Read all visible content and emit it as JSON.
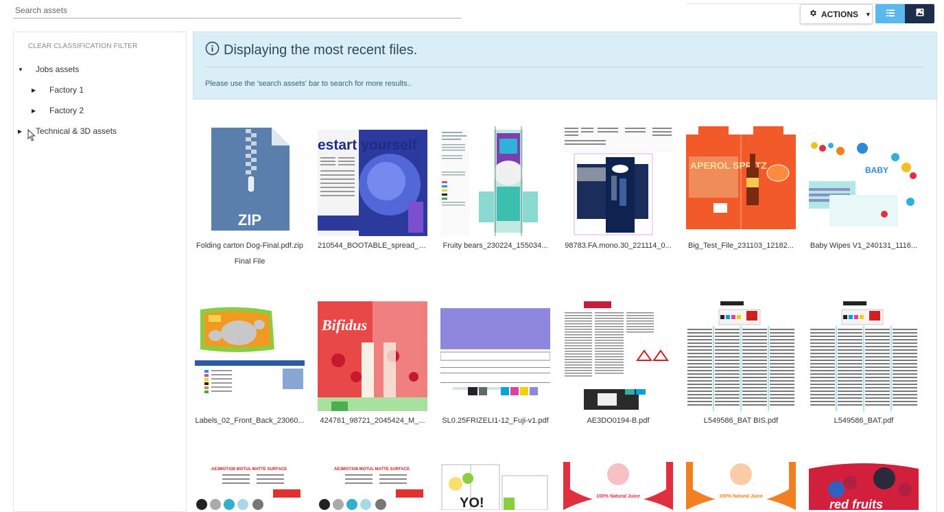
{
  "search": {
    "placeholder": "Search assets"
  },
  "toolbar": {
    "actions_label": "ACTIONS"
  },
  "sidebar": {
    "clear_filter": "CLEAR CLASSIFICATION FILTER",
    "items": [
      {
        "label": "Jobs assets"
      },
      {
        "label": "Factory 1"
      },
      {
        "label": "Factory 2"
      },
      {
        "label": "Technical & 3D assets"
      }
    ]
  },
  "banner": {
    "title": "Displaying the most recent files.",
    "subtitle": "Please use the 'search assets' bar to search for more results.."
  },
  "assets": [
    {
      "name": "Folding carton Dog-Final.pdf.zip",
      "tag": "Final File"
    },
    {
      "name": "210544_BOOTABLE_spread_0..."
    },
    {
      "name": "Fruity bears_230224_155034..."
    },
    {
      "name": "98783.FA.mono.30_221114_0..."
    },
    {
      "name": "Big_Test_File_231103_12182..."
    },
    {
      "name": "Baby Wipes V1_240131_1116..."
    },
    {
      "name": "Labels_02_Front_Back_23060..."
    },
    {
      "name": "424761_98721_2045424_M_..."
    },
    {
      "name": "SL0.25FRIZELI1-12_Fuji-v1.pdf"
    },
    {
      "name": "AE3DO0194-B.pdf"
    },
    {
      "name": "L549586_BAT BIS.pdf"
    },
    {
      "name": "L549586_BAT.pdf"
    }
  ],
  "thumb_text": {
    "zip": "ZIP",
    "bootable": "estart yourself",
    "aperol": "APEROL SPRITZ",
    "baby": "BABY",
    "bifidus": "Bifidus",
    "natural_juice": "100% Natural Juice",
    "red_fruits": "red fruits",
    "motul": "AE3MOT438 MOTUL MATTE SURFACE",
    "yo": "YO!"
  }
}
